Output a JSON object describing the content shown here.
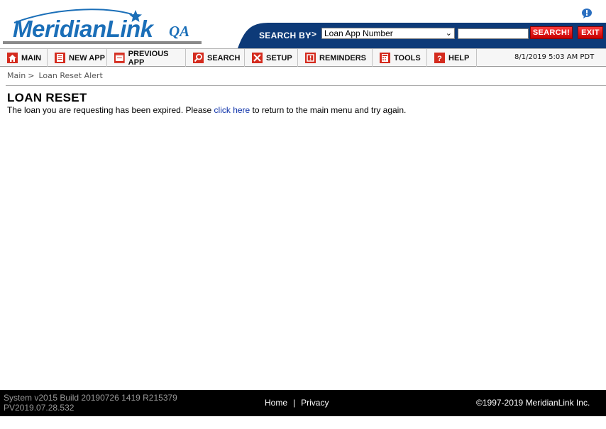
{
  "header": {
    "logo_text": "MeridianLink",
    "logo_badge": "QA",
    "search_label": "SEARCH BY",
    "search_arrow": "··>",
    "search_select_value": "Loan App Number",
    "search_input_value": "",
    "search_button": "SEARCH!",
    "exit_button": "EXIT",
    "accent_color": "#1b6fb8",
    "bar_color": "#0d3a78"
  },
  "nav": {
    "items": [
      {
        "label": "MAIN",
        "icon": "home-icon"
      },
      {
        "label": "NEW APP",
        "icon": "document-icon"
      },
      {
        "label": "PREVIOUS APP",
        "icon": "folder-icon"
      },
      {
        "label": "SEARCH",
        "icon": "magnifier-icon"
      },
      {
        "label": "SETUP",
        "icon": "tools-icon"
      },
      {
        "label": "REMINDERS",
        "icon": "alert-icon"
      },
      {
        "label": "TOOLS",
        "icon": "calculator-icon"
      },
      {
        "label": "HELP",
        "icon": "question-icon"
      }
    ],
    "datetime": "8/1/2019 5:03 AM PDT"
  },
  "breadcrumb": {
    "root": "Main",
    "separator": ">",
    "current": "Loan Reset Alert"
  },
  "content": {
    "title": "LOAN RESET",
    "message_before": "The loan you are requesting has been expired. Please ",
    "link_text": "click here",
    "message_after": " to return to the main menu and try again."
  },
  "footer": {
    "build_line1": "System v2015 Build 20190726 1419 R215379",
    "build_line2": "PV2019.07.28.532",
    "home_link": "Home",
    "link_separator": "|",
    "privacy_link": "Privacy",
    "copyright": "©1997-2019 MeridianLink Inc."
  }
}
